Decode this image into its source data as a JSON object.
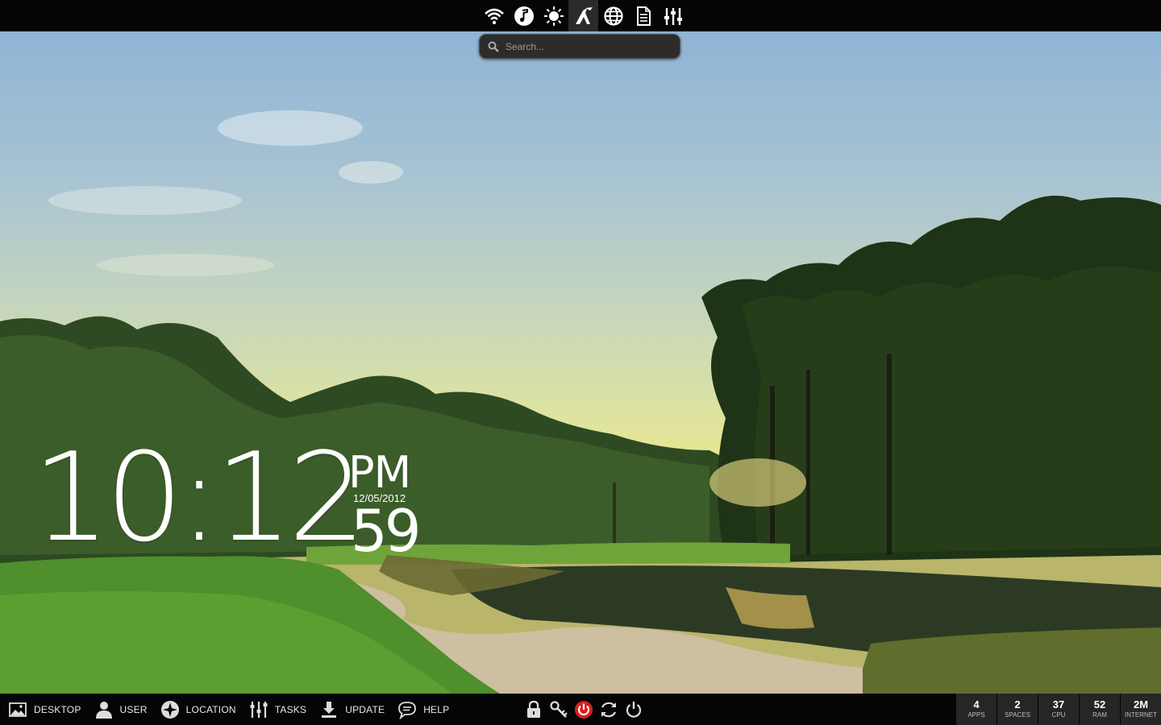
{
  "top_bar": {
    "icons": [
      {
        "name": "wifi-icon",
        "active": false
      },
      {
        "name": "music-icon",
        "active": false
      },
      {
        "name": "brightness-icon",
        "active": false
      },
      {
        "name": "launcher-logo-icon",
        "active": true
      },
      {
        "name": "globe-icon",
        "active": false
      },
      {
        "name": "document-icon",
        "active": false
      },
      {
        "name": "equalizer-icon",
        "active": false
      }
    ],
    "search": {
      "placeholder": "Search...",
      "value": ""
    }
  },
  "clock": {
    "time": "10:12",
    "ampm": "PM",
    "date": "12/05/2012",
    "seconds": "59"
  },
  "bottom_bar": {
    "items": [
      {
        "label": "DESKTOP",
        "icon": "landscape-icon"
      },
      {
        "label": "USER",
        "icon": "user-icon"
      },
      {
        "label": "LOCATION",
        "icon": "compass-icon"
      },
      {
        "label": "TASKS",
        "icon": "sliders-icon"
      },
      {
        "label": "UPDATE",
        "icon": "download-icon"
      },
      {
        "label": "HELP",
        "icon": "chat-icon"
      }
    ],
    "power_icons": [
      "lock-icon",
      "key-icon",
      "shutdown-icon",
      "restart-icon",
      "power-icon"
    ],
    "stats": [
      {
        "value": "4",
        "label": "APPS"
      },
      {
        "value": "2",
        "label": "SPACES"
      },
      {
        "value": "37",
        "label": "CPU"
      },
      {
        "value": "52",
        "label": "RAM"
      },
      {
        "value": "2M",
        "label": "INTERNET"
      }
    ]
  },
  "colors": {
    "bar_background": "#050505",
    "active_tab": "#2b2b2b",
    "stat_tile": "#262626",
    "shutdown_red": "#d9201e"
  }
}
